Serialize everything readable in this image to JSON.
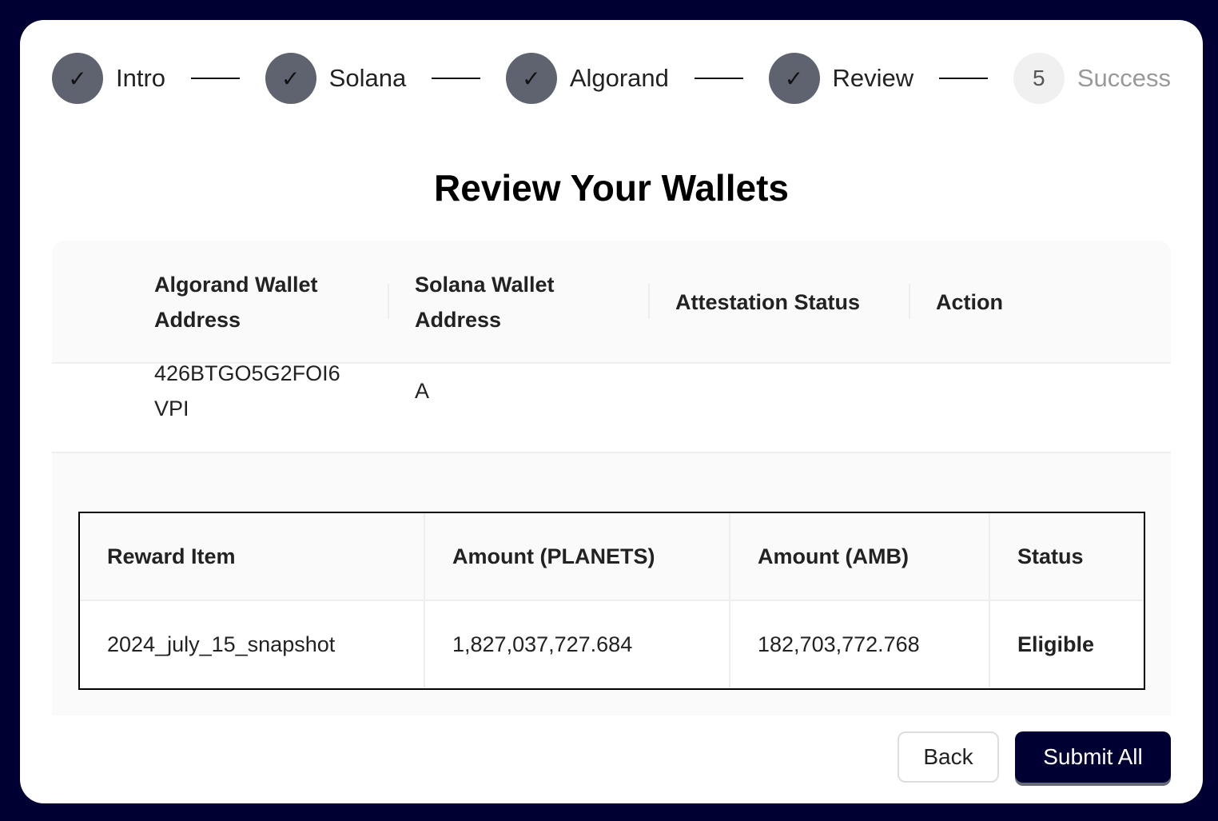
{
  "stepper": {
    "steps": [
      {
        "label": "Intro",
        "state": "done",
        "icon": "check-icon"
      },
      {
        "label": "Solana",
        "state": "done",
        "icon": "check-icon"
      },
      {
        "label": "Algorand",
        "state": "done",
        "icon": "check-icon"
      },
      {
        "label": "Review",
        "state": "done",
        "icon": "check-icon"
      },
      {
        "label": "Success",
        "state": "pending",
        "number": "5"
      }
    ]
  },
  "title": "Review Your Wallets",
  "wallet_table": {
    "headers": [
      "Algorand Wallet Address",
      "Solana Wallet Address",
      "Attestation Status",
      "Action"
    ],
    "row": {
      "algorand_visible": [
        "426BTGO5G2FOI6",
        "VPI"
      ],
      "solana_visible": "A"
    }
  },
  "reward_table": {
    "headers": [
      "Reward Item",
      "Amount (PLANETS)",
      "Amount (AMB)",
      "Status"
    ],
    "rows": [
      {
        "item": "2024_july_15_snapshot",
        "planets": "1,827,037,727.684",
        "amb": "182,703,772.768",
        "status": "Eligible"
      }
    ]
  },
  "buttons": {
    "back": "Back",
    "submit": "Submit All"
  },
  "colors": {
    "background": "#000033",
    "step_done": "#5f6370",
    "eligible": "#1a8a1a",
    "primary": "#000033"
  }
}
